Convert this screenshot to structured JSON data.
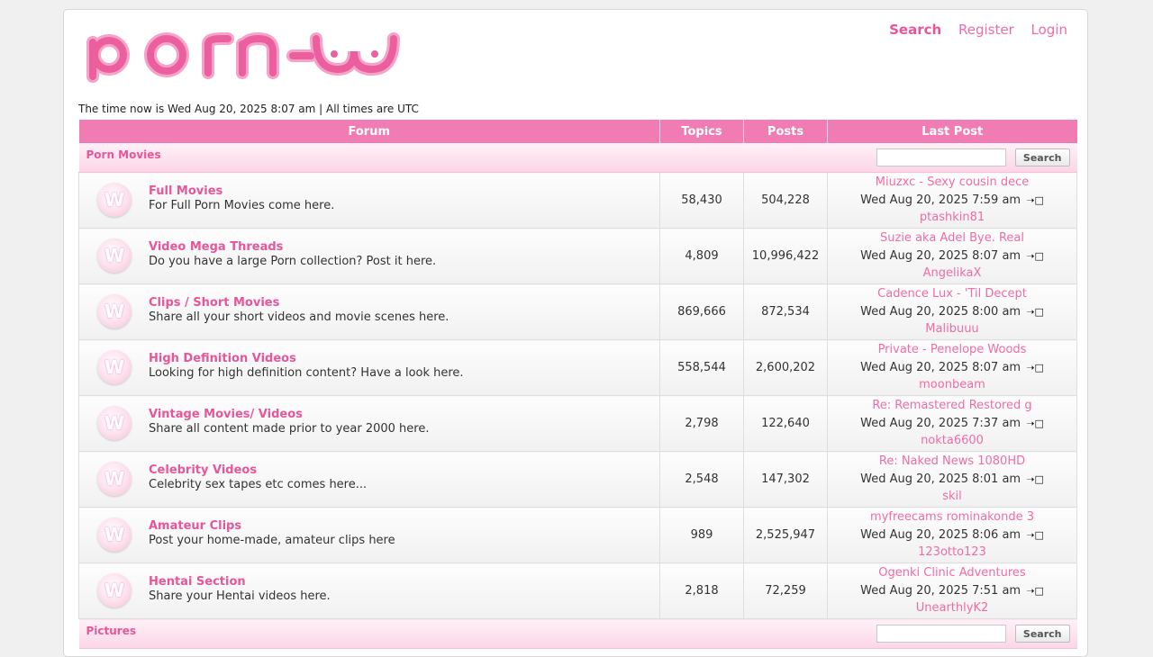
{
  "header": {
    "logo_text": "porn-ω",
    "links": [
      {
        "label": "Search"
      },
      {
        "label": "Register"
      },
      {
        "label": "Login"
      }
    ]
  },
  "time_line": "The time now is Wed Aug 20, 2025 8:07 am | All times are UTC",
  "table": {
    "columns": [
      "Forum",
      "Topics",
      "Posts",
      "Last Post"
    ]
  },
  "categories": [
    {
      "title": "Porn Movies",
      "search_label": "Search",
      "forums": [
        {
          "title": "Full Movies",
          "desc": "For Full Porn Movies come here.",
          "topics": "58,430",
          "posts": "504,228",
          "last_title": "Miuzxc - Sexy cousin dece",
          "last_time": "Wed Aug 20, 2025 7:59 am",
          "last_user": "ptashkin81"
        },
        {
          "title": "Video Mega Threads",
          "desc": "Do you have a large Porn collection? Post it here.",
          "topics": "4,809",
          "posts": "10,996,422",
          "last_title": "Suzie aka Adel Bye. Real",
          "last_time": "Wed Aug 20, 2025 8:07 am",
          "last_user": "AngelikaX"
        },
        {
          "title": "Clips / Short Movies",
          "desc": "Share all your short videos and movie scenes here.",
          "topics": "869,666",
          "posts": "872,534",
          "last_title": "Cadence Lux - 'Til Decept",
          "last_time": "Wed Aug 20, 2025 8:00 am",
          "last_user": "Malibuuu"
        },
        {
          "title": "High Definition Videos",
          "desc": "Looking for high definition content? Have a look here.",
          "topics": "558,544",
          "posts": "2,600,202",
          "last_title": "Private - Penelope Woods",
          "last_time": "Wed Aug 20, 2025 8:07 am",
          "last_user": "moonbeam"
        },
        {
          "title": "Vintage Movies/ Videos",
          "desc": "Share all content made prior to year 2000 here.",
          "topics": "2,798",
          "posts": "122,640",
          "last_title": "Re: Remastered Restored g",
          "last_time": "Wed Aug 20, 2025 7:37 am",
          "last_user": "nokta6600"
        },
        {
          "title": "Celebrity Videos",
          "desc": "Celebrity sex tapes etc comes here...",
          "topics": "2,548",
          "posts": "147,302",
          "last_title": "Re: Naked News 1080HD",
          "last_time": "Wed Aug 20, 2025 8:01 am",
          "last_user": "skil"
        },
        {
          "title": "Amateur Clips",
          "desc": "Post your home-made, amateur clips here",
          "topics": "989",
          "posts": "2,525,947",
          "last_title": "myfreecams rominakonde 3",
          "last_time": "Wed Aug 20, 2025 8:06 am",
          "last_user": "123otto123"
        },
        {
          "title": "Hentai Section",
          "desc": "Share your Hentai videos here.",
          "topics": "2,818",
          "posts": "72,259",
          "last_title": "Ogenki Clinic Adventures",
          "last_time": "Wed Aug 20, 2025 7:51 am",
          "last_user": "UnearthlyK2"
        }
      ]
    },
    {
      "title": "Pictures",
      "search_label": "Search",
      "forums": []
    }
  ],
  "icons": {
    "forum": "forum-read-icon",
    "goto": "go-to-post-icon"
  },
  "colors": {
    "accent": "#f06ca6",
    "header_bg": "#f07cb3",
    "category_bg": "#fbd5e6"
  }
}
